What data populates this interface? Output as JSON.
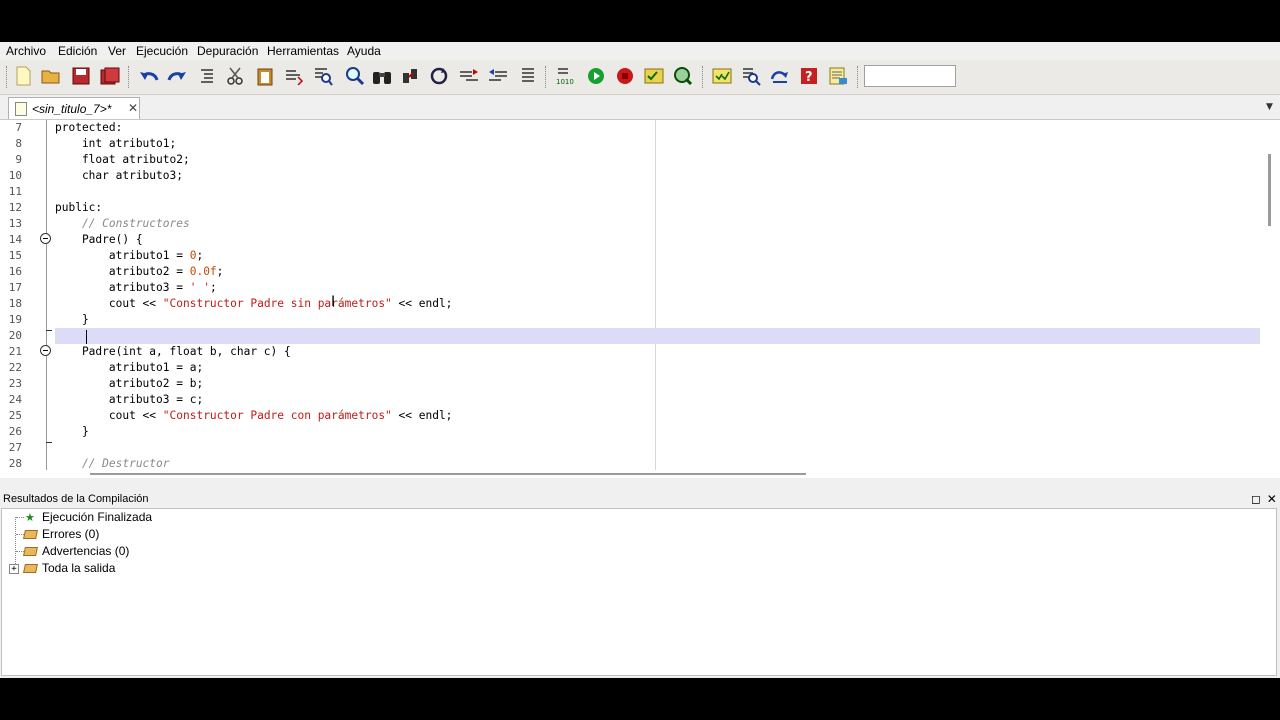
{
  "menu": [
    "Archivo",
    "Edición",
    "Ver",
    "Ejecución",
    "Depuración",
    "Herramientas",
    "Ayuda"
  ],
  "toolbar_icons": [
    "new-file",
    "open-folder",
    "save",
    "save-all",
    "undo",
    "redo",
    "indent",
    "cut",
    "paste",
    "find-replace",
    "find-files",
    "zoom-search",
    "binoculars",
    "goto",
    "refresh",
    "compare",
    "compare-back",
    "list",
    "compile",
    "run",
    "stop",
    "debug",
    "inspect",
    "check",
    "search-doc",
    "replace",
    "help",
    "notes"
  ],
  "search": {
    "value": ""
  },
  "tab": {
    "label": "<sin_titulo_7>*",
    "close": "✕"
  },
  "editor": {
    "lines": [
      {
        "n": "7",
        "code": "protected:"
      },
      {
        "n": "8",
        "code": "    int atributo1;"
      },
      {
        "n": "9",
        "code": "    float atributo2;"
      },
      {
        "n": "10",
        "code": "    char atributo3;"
      },
      {
        "n": "11",
        "code": ""
      },
      {
        "n": "12",
        "code": "public:"
      },
      {
        "n": "13",
        "code": "    // Constructores"
      },
      {
        "n": "14",
        "code": "    Padre() {"
      },
      {
        "n": "15",
        "code": "        atributo1 = 0;"
      },
      {
        "n": "16",
        "code": "        atributo2 = 0.0f;"
      },
      {
        "n": "17",
        "code": "        atributo3 = ' ';"
      },
      {
        "n": "18",
        "code": "        cout << \"Constructor Padre sin parámetros\" << endl;"
      },
      {
        "n": "19",
        "code": "    }"
      },
      {
        "n": "20",
        "code": ""
      },
      {
        "n": "21",
        "code": "    Padre(int a, float b, char c) {"
      },
      {
        "n": "22",
        "code": "        atributo1 = a;"
      },
      {
        "n": "23",
        "code": "        atributo2 = b;"
      },
      {
        "n": "24",
        "code": "        atributo3 = c;"
      },
      {
        "n": "25",
        "code": "        cout << \"Constructor Padre con parámetros\" << endl;"
      },
      {
        "n": "26",
        "code": "    }"
      },
      {
        "n": "27",
        "code": ""
      },
      {
        "n": "28",
        "code": "    // Destructor"
      }
    ],
    "current_line": "20"
  },
  "results": {
    "title": "Resultados de la Compilación",
    "items": [
      "Ejecución Finalizada",
      "Errores (0)",
      "Advertencias (0)",
      "Toda la salida"
    ]
  }
}
